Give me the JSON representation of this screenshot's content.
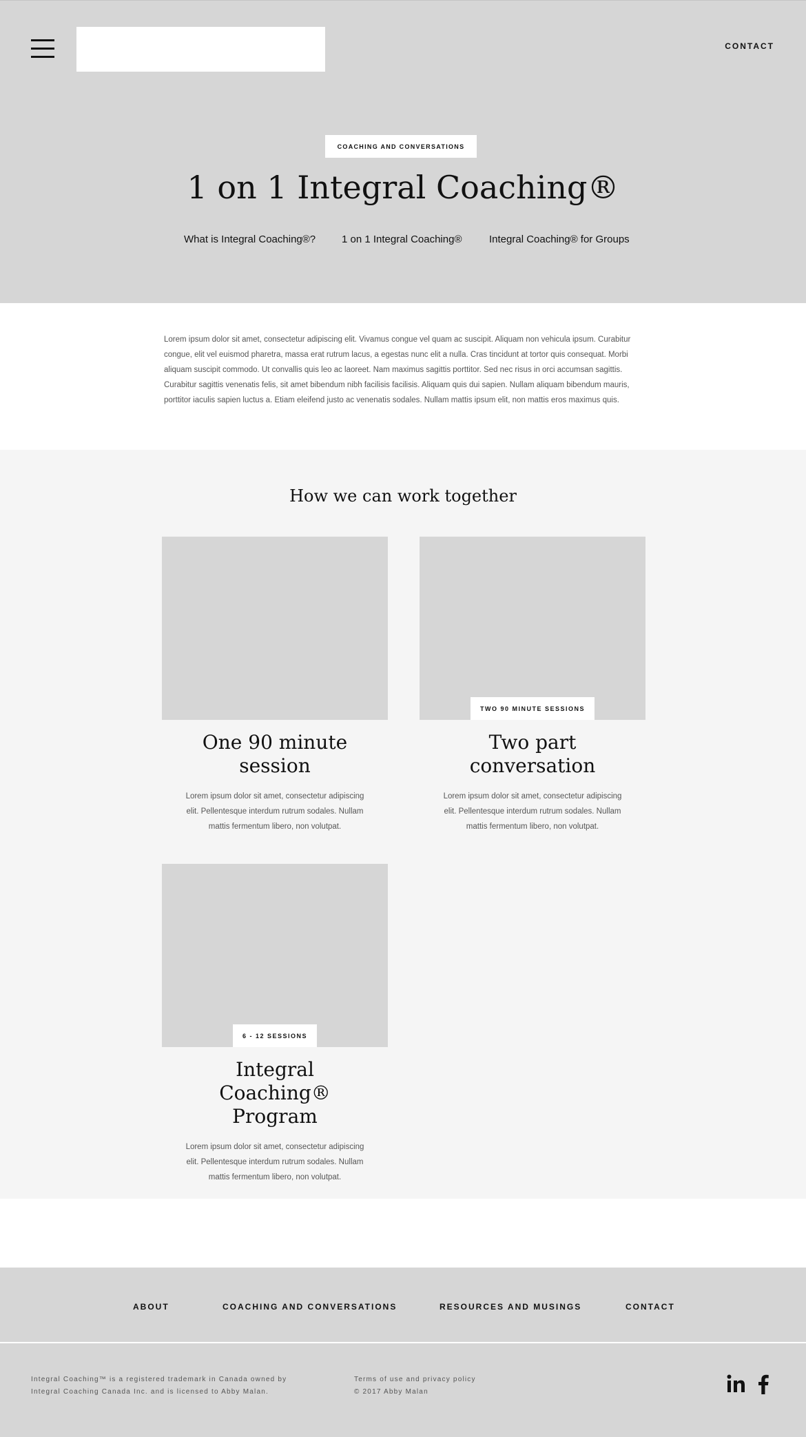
{
  "header": {
    "contact_label": "CONTACT"
  },
  "hero": {
    "eyebrow": "COACHING AND CONVERSATIONS",
    "title": "1 on 1 Integral Coaching®",
    "links": [
      "What is Integral Coaching®?",
      "1 on 1 Integral Coaching®",
      "Integral Coaching® for Groups"
    ]
  },
  "intro": {
    "text": "Lorem ipsum dolor sit amet, consectetur adipiscing elit. Vivamus congue vel quam ac suscipit. Aliquam non vehicula ipsum. Curabitur congue, elit vel euismod pharetra, massa erat rutrum lacus, a egestas nunc elit a nulla. Cras tincidunt at tortor quis consequat. Morbi aliquam suscipit commodo. Ut convallis quis leo ac laoreet. Nam maximus sagittis porttitor. Sed nec risus in orci accumsan sagittis. Curabitur sagittis venenatis felis, sit amet bibendum nibh facilisis facilisis. Aliquam quis dui sapien. Nullam aliquam bibendum mauris, porttitor iaculis sapien luctus a. Etiam eleifend justo ac venenatis sodales. Nullam mattis ipsum elit, non mattis eros maximus quis."
  },
  "services": {
    "heading": "How we can work together",
    "cards": [
      {
        "badge": "",
        "title": "One 90 minute session",
        "text": "Lorem ipsum dolor sit amet, consectetur adipiscing elit. Pellentesque interdum rutrum sodales. Nullam mattis fermentum libero, non volutpat."
      },
      {
        "badge": "TWO 90 MINUTE SESSIONS",
        "title": "Two part conversation",
        "text": "Lorem ipsum dolor sit amet, consectetur adipiscing elit. Pellentesque interdum rutrum sodales. Nullam mattis fermentum libero, non volutpat."
      },
      {
        "badge": "6 - 12 SESSIONS",
        "title": "Integral Coaching® Program",
        "text": "Lorem ipsum dolor sit amet, consectetur adipiscing elit. Pellentesque interdum rutrum sodales. Nullam mattis fermentum libero, non volutpat."
      }
    ]
  },
  "footer": {
    "nav": [
      "ABOUT",
      "COACHING AND CONVERSATIONS",
      "RESOURCES AND MUSINGS",
      "CONTACT"
    ],
    "legal_line1": "Integral Coaching™ is a registered trademark in Canada owned by",
    "legal_line2": "Integral Coaching Canada Inc. and is licensed to Abby Malan.",
    "terms_label": "Terms of use and privacy policy",
    "copyright": "© 2017 Abby Malan",
    "social_icons": [
      "linkedin-icon",
      "facebook-icon"
    ]
  },
  "colors": {
    "hero_bg": "#d6d6d6",
    "services_bg": "#f5f5f5",
    "placeholder": "#d6d6d6",
    "text": "#111111",
    "muted_text": "#555555"
  }
}
